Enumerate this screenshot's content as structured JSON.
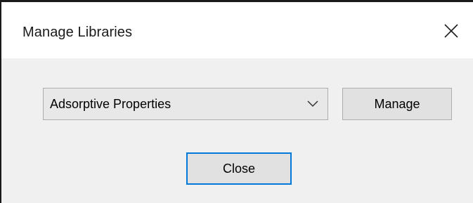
{
  "window": {
    "title": "Manage Libraries",
    "close_icon": "close-icon"
  },
  "library_select": {
    "selected": "Adsorptive Properties",
    "arrow_icon": "chevron-down-icon"
  },
  "buttons": {
    "manage_label": "Manage",
    "close_label": "Close"
  },
  "colors": {
    "focus_border": "#0078d7",
    "dialog_bg": "#f0f0f0",
    "button_bg": "#e1e1e1"
  }
}
